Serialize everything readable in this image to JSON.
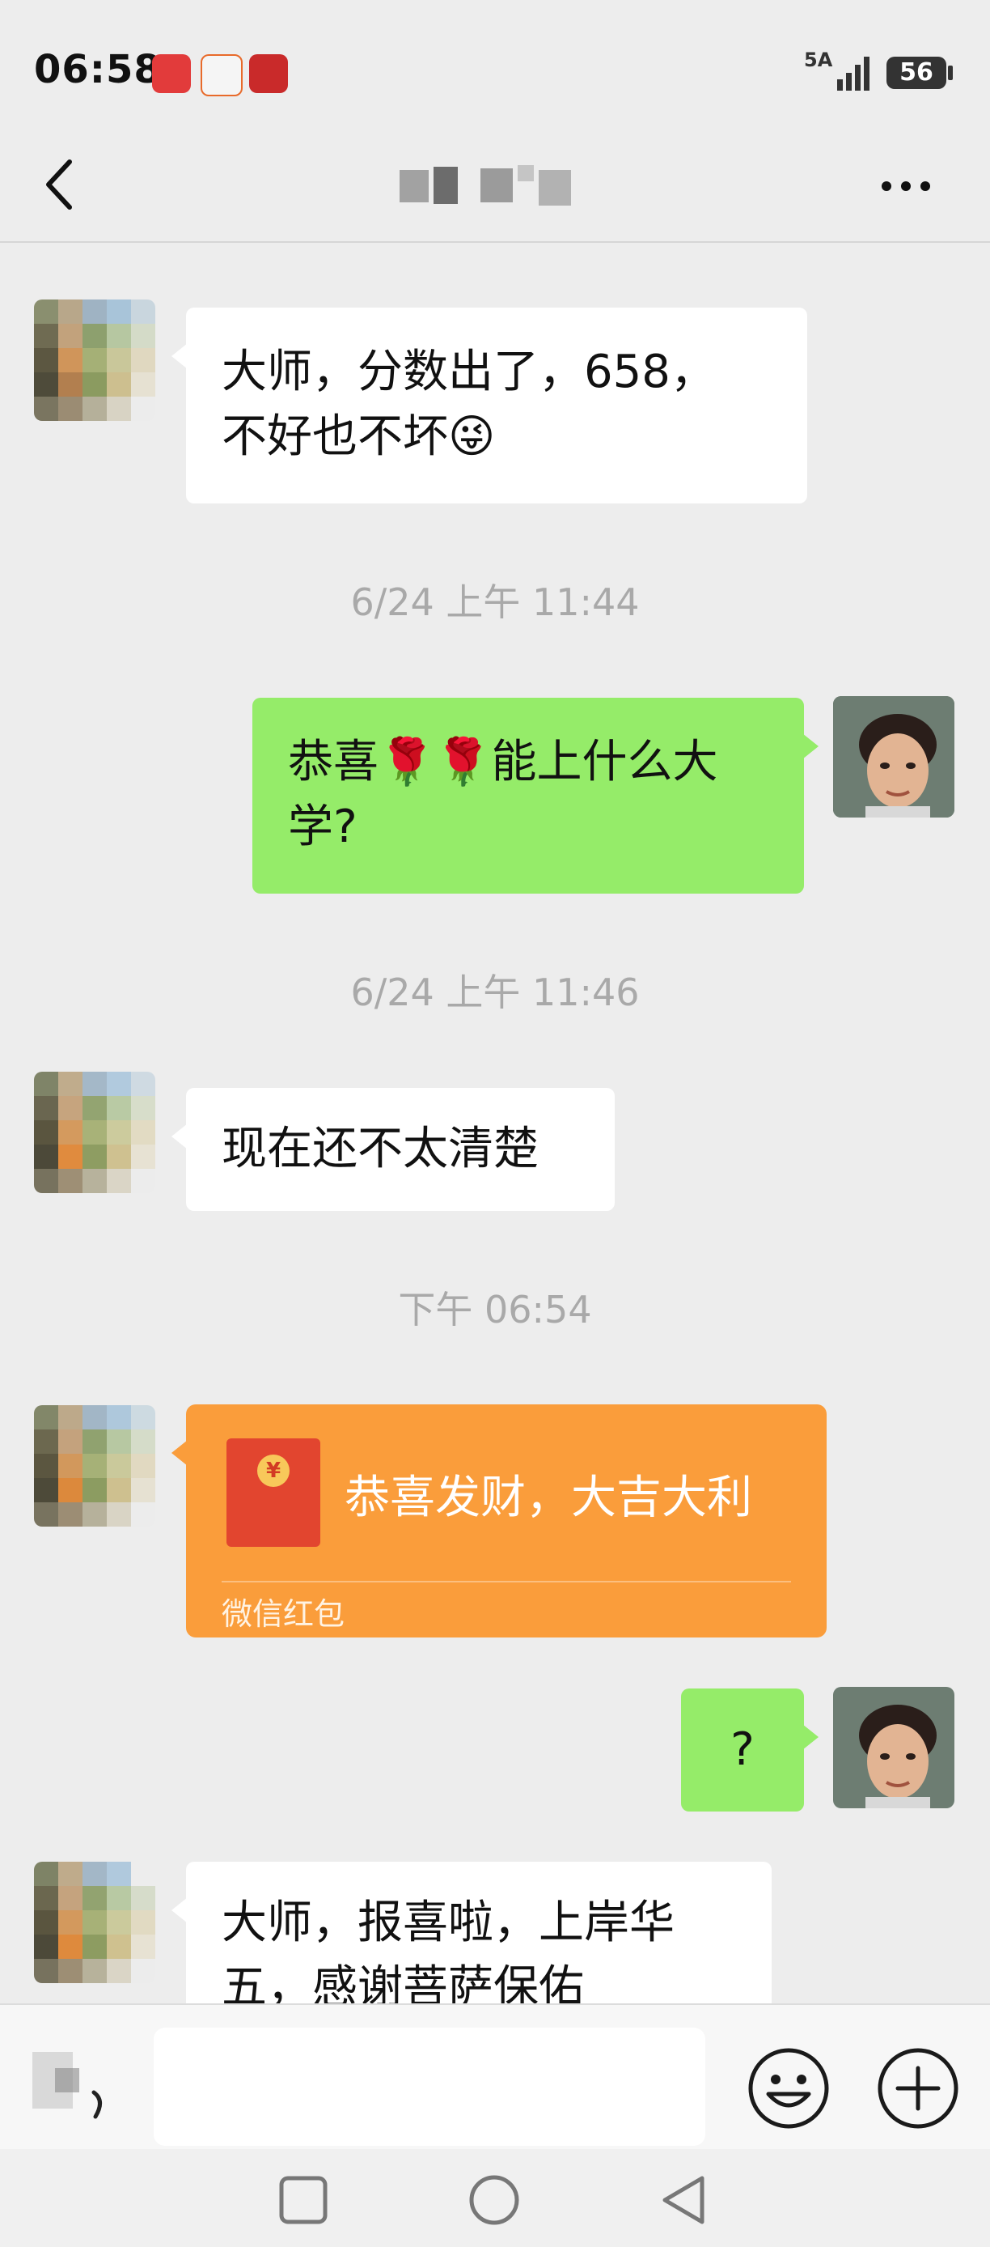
{
  "status_bar": {
    "time": "06:58",
    "network": "5A",
    "battery": "56"
  },
  "nav": {
    "title": "",
    "icons": [
      "back-chevron-icon",
      "more-dots-icon"
    ]
  },
  "messages": [
    {
      "side": "in",
      "text_line1": "大师，分数出了，658，",
      "text_line2": "不好也不坏😜"
    },
    {
      "type": "timestamp",
      "text": "6/24 上午 11:44"
    },
    {
      "side": "out",
      "text_line1": "恭喜🌹🌹能上什么大",
      "text_line2": "学?"
    },
    {
      "type": "timestamp",
      "text": "6/24 上午 11:46"
    },
    {
      "side": "in",
      "text": "现在还不太清楚"
    },
    {
      "type": "timestamp",
      "text": "下午 06:54"
    },
    {
      "side": "in",
      "type": "red_packet",
      "title": "恭喜发财，大吉大利",
      "caption": "微信红包",
      "seal": "¥"
    },
    {
      "side": "out",
      "text": "?"
    },
    {
      "side": "in",
      "text_line1": "大师，报喜啦，上岸华",
      "text_line2": "五，感谢菩萨保佑"
    }
  ],
  "colors": {
    "background": "#ededed",
    "bubble_in": "#ffffff",
    "bubble_out": "#95ec69",
    "red_packet": "#fa9d3b",
    "timestamp": "#a9a9a9"
  },
  "input_bar": {
    "icons": [
      "voice-icon",
      "emoji-icon",
      "plus-icon"
    ]
  },
  "system_nav": {
    "icons": [
      "recent-apps-icon",
      "home-icon",
      "back-triangle-icon"
    ]
  }
}
